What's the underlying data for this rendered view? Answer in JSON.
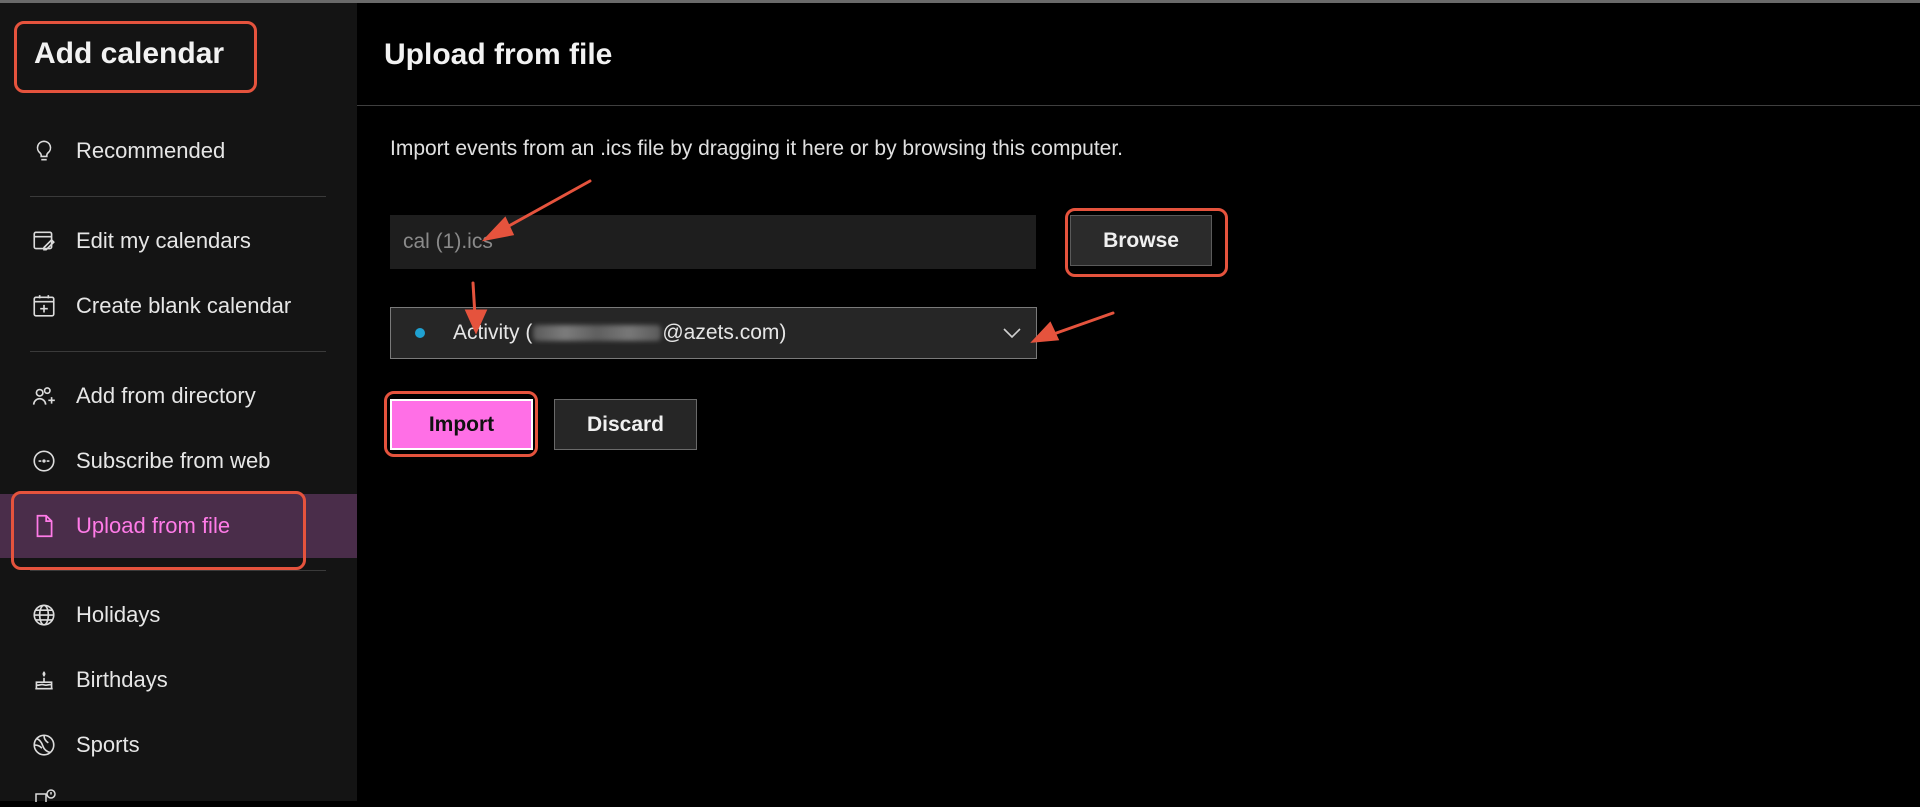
{
  "sidebar": {
    "title": "Add calendar",
    "items": [
      {
        "label": "Recommended",
        "icon": "lightbulb-icon"
      },
      {
        "label": "Edit my calendars",
        "icon": "calendar-edit-icon"
      },
      {
        "label": "Create blank calendar",
        "icon": "calendar-add-icon"
      },
      {
        "label": "Add from directory",
        "icon": "people-add-icon"
      },
      {
        "label": "Subscribe from web",
        "icon": "link-circle-icon"
      },
      {
        "label": "Upload from file",
        "icon": "document-icon",
        "selected": true
      },
      {
        "label": "Holidays",
        "icon": "globe-icon"
      },
      {
        "label": "Birthdays",
        "icon": "cake-icon"
      },
      {
        "label": "Sports",
        "icon": "sports-ball-icon"
      }
    ]
  },
  "main": {
    "title": "Upload from file",
    "description": "Import events from an .ics file by dragging it here or by browsing this computer.",
    "file_field": {
      "value": "cal (1).ics"
    },
    "browse_label": "Browse",
    "calendar_select": {
      "prefix": "Activity (",
      "suffix": "@azets.com)",
      "dot_color": "#1fa1d1"
    },
    "import_label": "Import",
    "discard_label": "Discard"
  },
  "colors": {
    "accent": "#ff6fe6",
    "selected_bg": "#4a2d4a",
    "annotation": "#e5533d"
  }
}
